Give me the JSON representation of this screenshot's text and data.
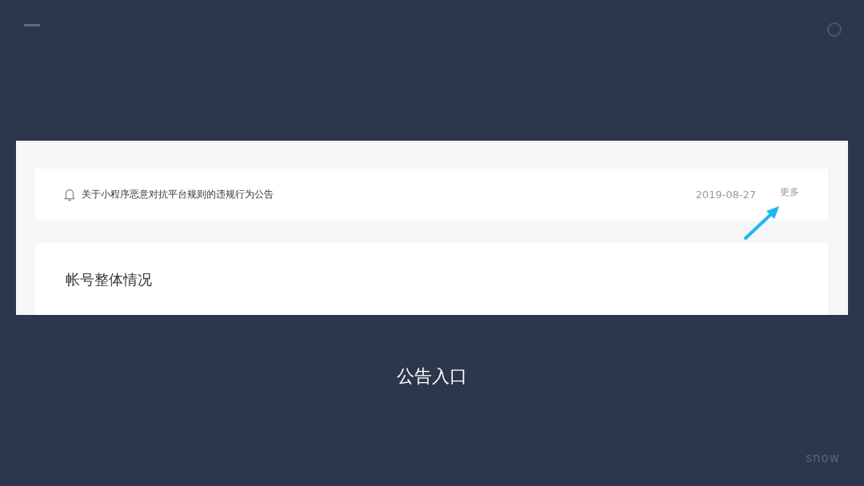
{
  "notice": {
    "title": "关于小程序恶意对抗平台规则的违规行为公告",
    "date": "2019-08-27",
    "more": "更多"
  },
  "section": {
    "title": "帐号整体情况"
  },
  "caption": "公告入口",
  "logo": "snow"
}
